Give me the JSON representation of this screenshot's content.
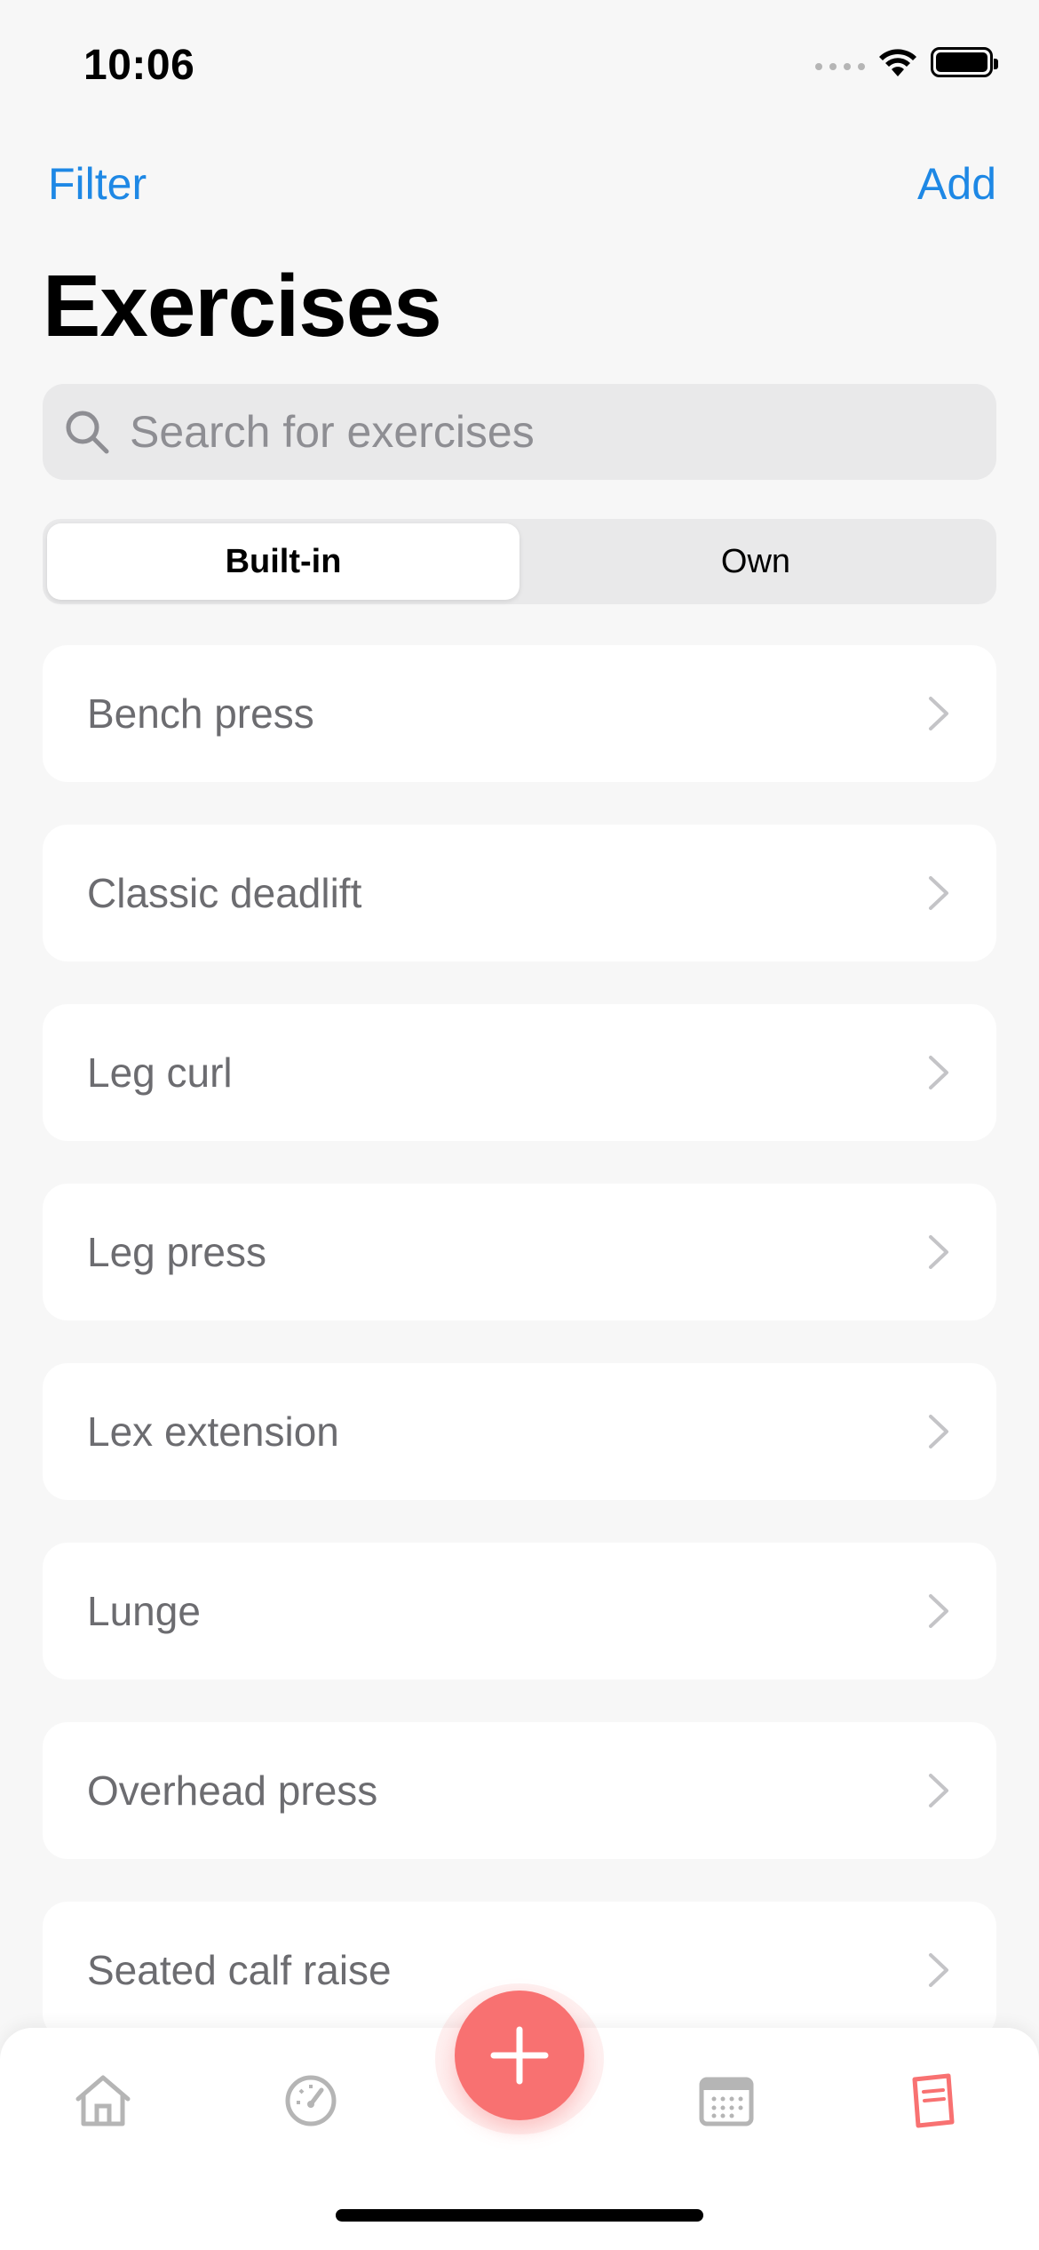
{
  "status": {
    "time": "10:06"
  },
  "nav": {
    "left": "Filter",
    "right": "Add"
  },
  "page": {
    "title": "Exercises"
  },
  "search": {
    "placeholder": "Search for exercises",
    "value": ""
  },
  "segments": {
    "builtin": "Built-in",
    "own": "Own",
    "selected": "Built-in"
  },
  "exercises": [
    {
      "label": "Bench press"
    },
    {
      "label": "Classic deadlift"
    },
    {
      "label": "Leg curl"
    },
    {
      "label": "Leg press"
    },
    {
      "label": "Lex extension"
    },
    {
      "label": "Lunge"
    },
    {
      "label": "Overhead press"
    },
    {
      "label": "Seated calf raise"
    }
  ],
  "tabs": [
    {
      "icon": "home-icon",
      "active": false
    },
    {
      "icon": "gauge-icon",
      "active": false
    },
    {
      "icon": "calendar-icon",
      "active": false
    },
    {
      "icon": "notebook-icon",
      "active": true
    }
  ],
  "colors": {
    "accent": "#1e88e5",
    "fab": "#f87171",
    "inactive_tab": "#b5b5b5",
    "active_tab": "#f87171"
  }
}
